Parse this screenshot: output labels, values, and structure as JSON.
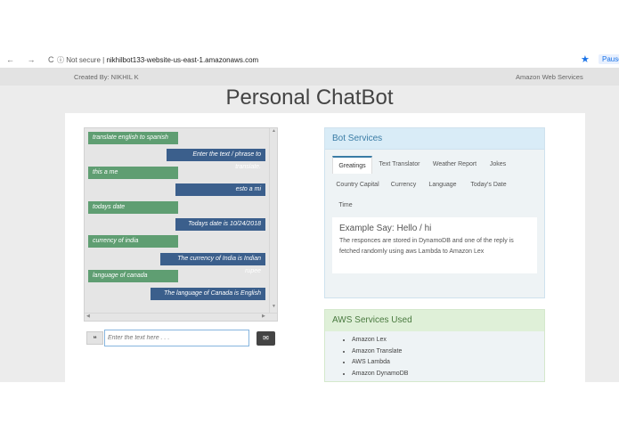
{
  "browser": {
    "nav_arrows": "← → C",
    "site_info": "ⓘ Not secure",
    "url": "nikhilbot133-website-us-east-1.amazonaws.com",
    "pause_label": "Pause"
  },
  "header": {
    "created_by": "Created By: NIKHIL K",
    "aws_link": "Amazon Web Services"
  },
  "page_title": "Personal ChatBot",
  "chat": {
    "messages": [
      {
        "sender": "user",
        "text": "translate english to spanish"
      },
      {
        "sender": "bot",
        "text": "Enter the text / phrase to translate."
      },
      {
        "sender": "user",
        "text": "this a me"
      },
      {
        "sender": "bot",
        "text": "esto a mi"
      },
      {
        "sender": "user",
        "text": "todays date"
      },
      {
        "sender": "bot",
        "text": "Todays date is 10/24/2018"
      },
      {
        "sender": "user",
        "text": "currency of india"
      },
      {
        "sender": "bot",
        "text": "The currency of India is Indian rupee"
      },
      {
        "sender": "user",
        "text": "language of canada"
      },
      {
        "sender": "bot",
        "text": "The language of Canada is English"
      }
    ],
    "input_placeholder": "Enter the text here . . .",
    "quote_icon": "❝",
    "send_icon": "✉"
  },
  "bot_services": {
    "heading": "Bot Services",
    "tabs": [
      "Greatings",
      "Text Translator",
      "Weather Report",
      "Jokes",
      "Country Capital",
      "Currency",
      "Language",
      "Today's Date",
      "Time"
    ],
    "active_tab": "Greatings",
    "example_title": "Example Say: Hello / hi",
    "example_desc": "The responces are stored in DynamoDB and one of the reply is fetched randomly using aws Lambda to Amazon Lex"
  },
  "aws_services": {
    "heading": "AWS Services Used",
    "items": [
      "Amazon Lex",
      "Amazon Translate",
      "AWS Lambda",
      "Amazon DynamoDB"
    ]
  }
}
